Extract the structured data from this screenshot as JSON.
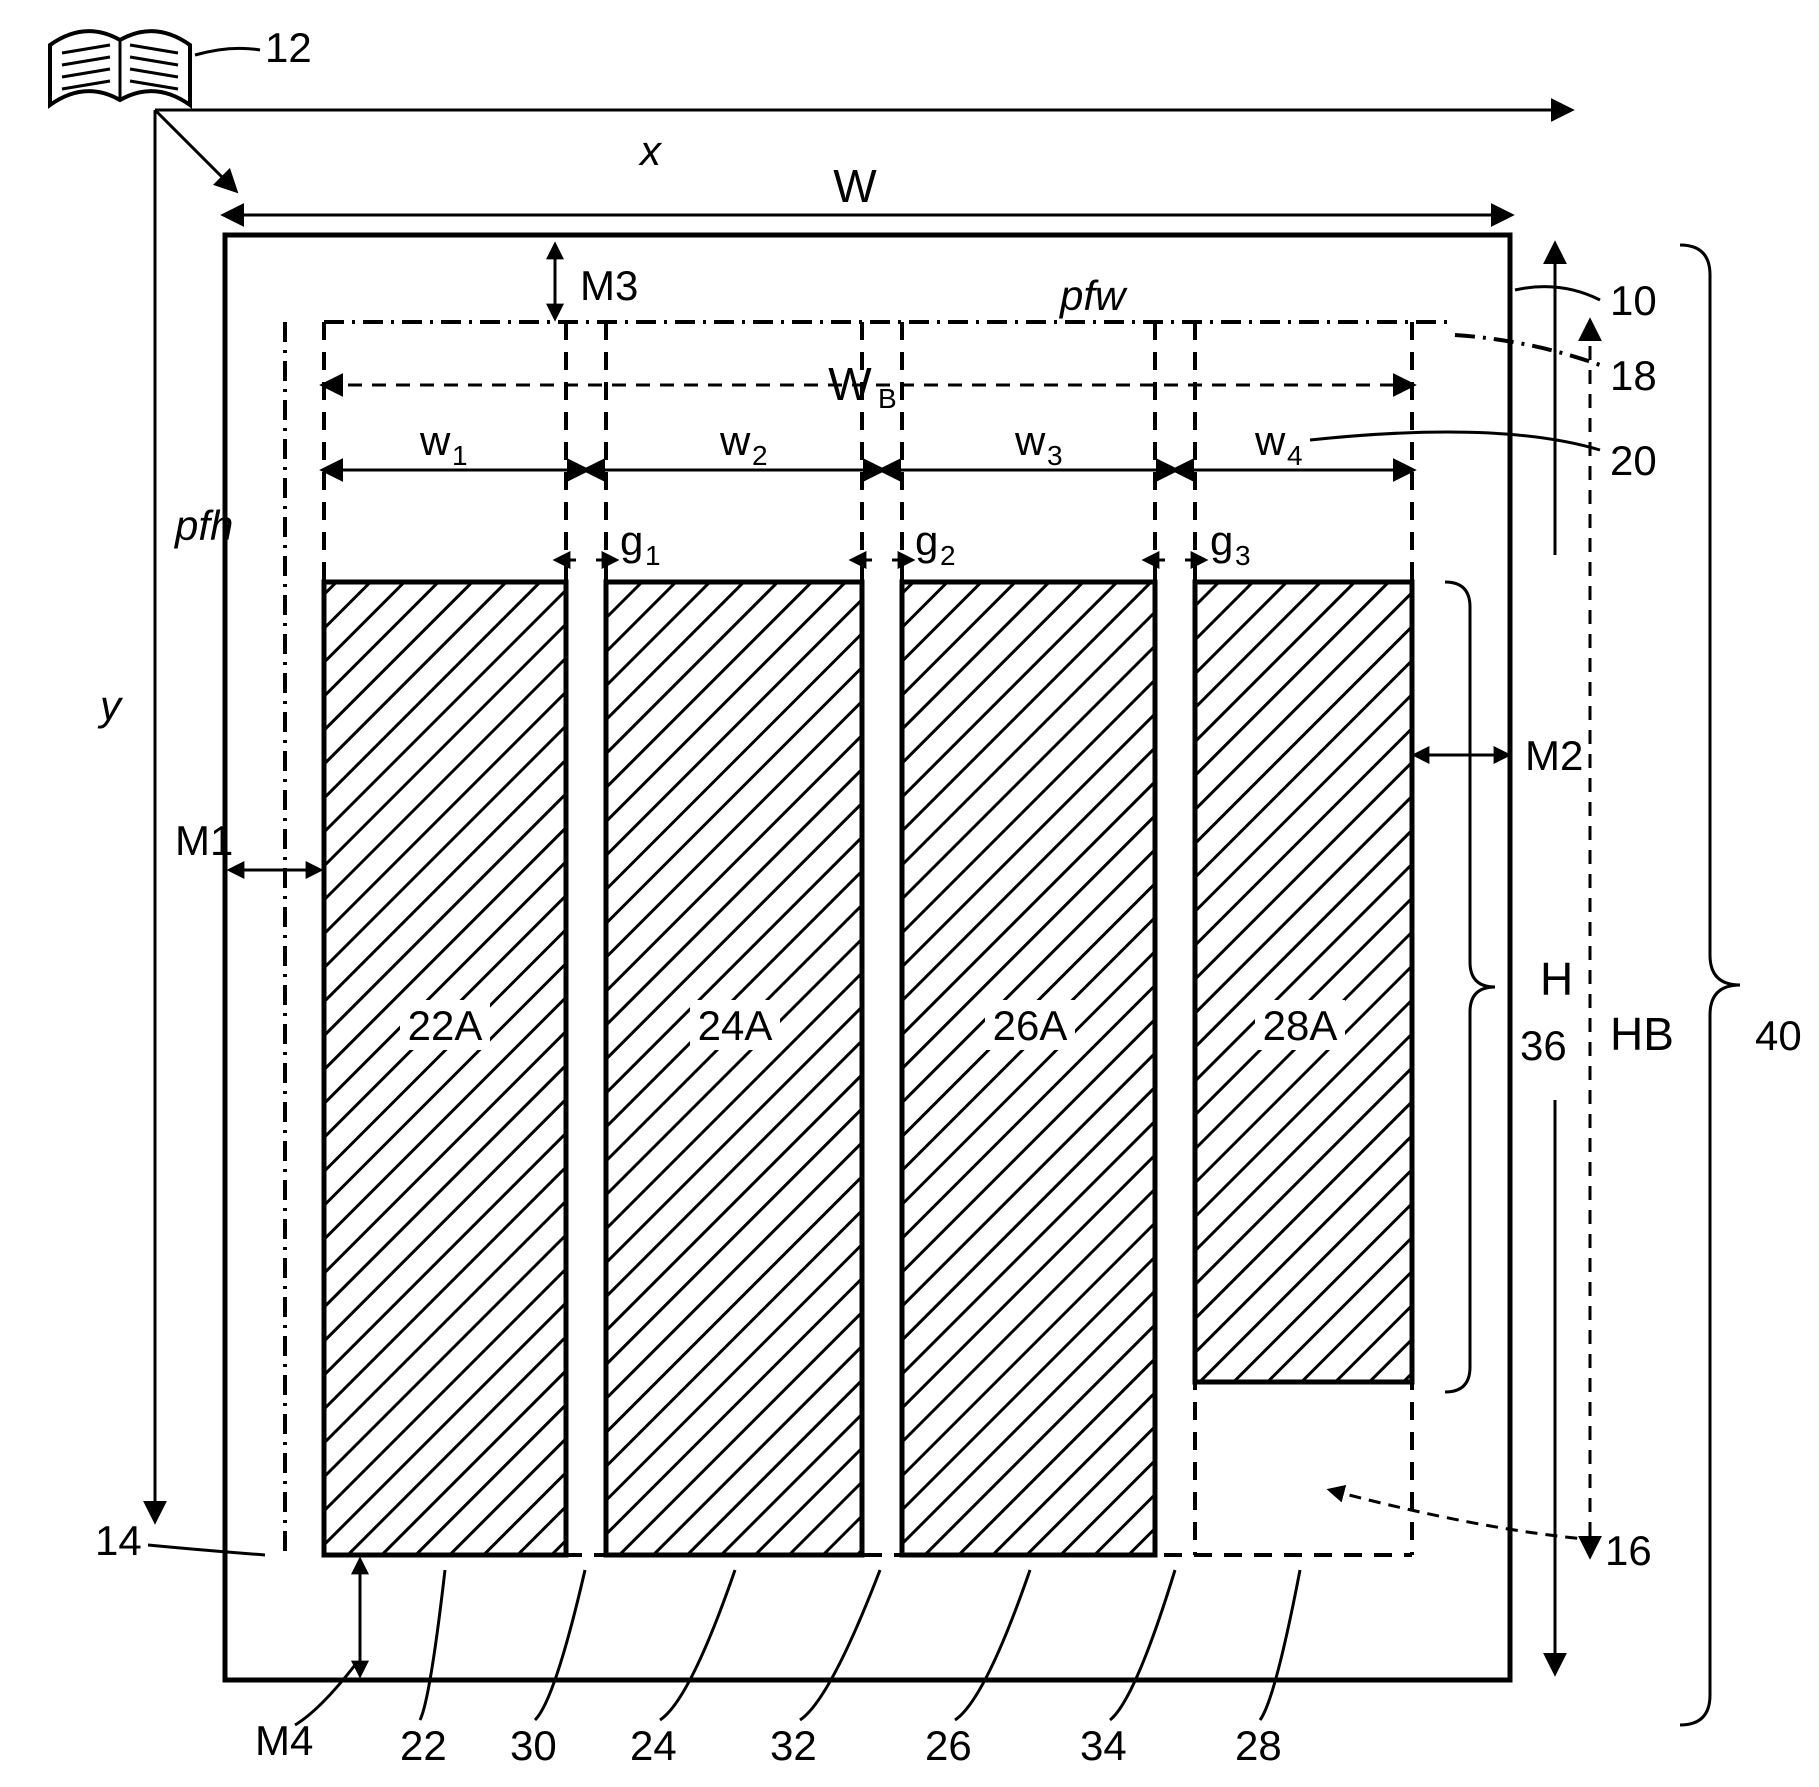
{
  "labels": {
    "x": "x",
    "y": "y",
    "W": "W",
    "WB_base": "W",
    "WB_sub": "B",
    "pfw": "pfw",
    "pfh": "pfh",
    "M1": "M1",
    "M2": "M2",
    "M3": "M3",
    "M4": "M4",
    "w1b": "w",
    "w1s": "1",
    "w2b": "w",
    "w2s": "2",
    "w3b": "w",
    "w3s": "3",
    "w4b": "w",
    "w4s": "4",
    "g1b": "g",
    "g1s": "1",
    "g2b": "g",
    "g2s": "2",
    "g3b": "g",
    "g3s": "3",
    "c22A": "22A",
    "c24A": "24A",
    "c26A": "26A",
    "c28A": "28A",
    "H": "H",
    "HB": "HB",
    "n10": "10",
    "n12": "12",
    "n14": "14",
    "n16": "16",
    "n18": "18",
    "n20": "20",
    "n22": "22",
    "n24": "24",
    "n26": "26",
    "n28": "28",
    "n30": "30",
    "n32": "32",
    "n34": "34",
    "n36": "36",
    "n40": "40"
  },
  "chart_data": {
    "type": "diagram",
    "description": "Page layout / column width specification drawing",
    "page_box_ref": 10,
    "book_icon_ref": 12,
    "columns": [
      {
        "ref": 22,
        "content_ref": "22A",
        "width_symbol": "w1"
      },
      {
        "ref": 24,
        "content_ref": "24A",
        "width_symbol": "w2"
      },
      {
        "ref": 26,
        "content_ref": "26A",
        "width_symbol": "w3"
      },
      {
        "ref": 28,
        "content_ref": "28A",
        "width_symbol": "w4"
      }
    ],
    "gutters": [
      {
        "ref": 30,
        "symbol": "g1"
      },
      {
        "ref": 32,
        "symbol": "g2"
      },
      {
        "ref": 34,
        "symbol": "g3"
      }
    ],
    "margins": {
      "left": "M1",
      "right": "M2",
      "top": "M3",
      "bottom": "M4"
    },
    "widths": {
      "page": "W",
      "body": "WB",
      "printfield": "pfw"
    },
    "heights": {
      "page": "H",
      "body": "HB",
      "printfield": "pfh"
    },
    "braces": {
      "H_ref": 36,
      "HB_ref": 40
    },
    "lower_bound_ref": 14,
    "partial_rect_ref": 16,
    "printfield_ref": 18,
    "width_group_ref": 20
  }
}
